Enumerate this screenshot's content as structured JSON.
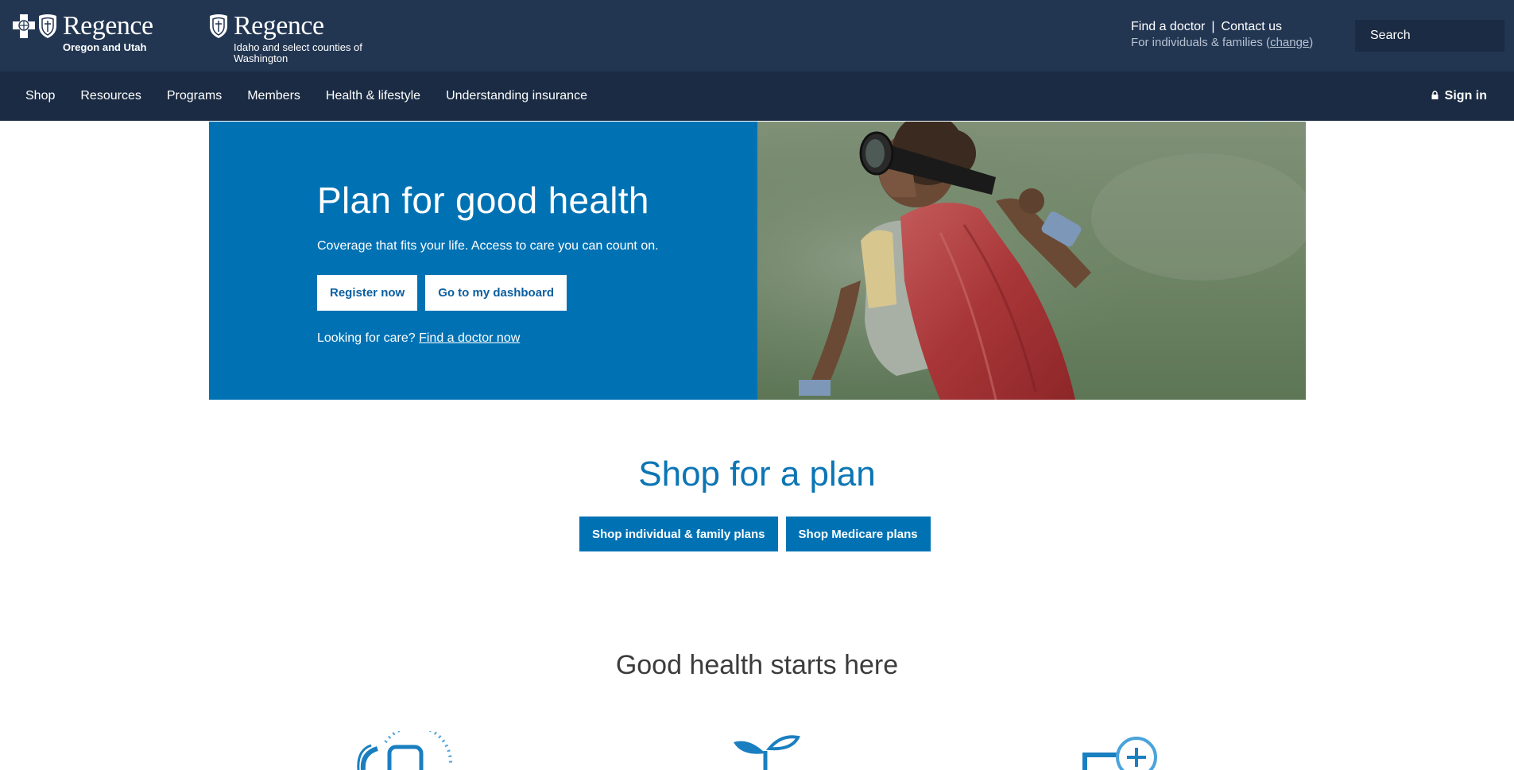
{
  "header": {
    "logo_left": {
      "brand": "Regence",
      "region": "Oregon and Utah"
    },
    "logo_right": {
      "brand": "Regence",
      "region": "Idaho and select counties of Washington"
    },
    "find_doctor": "Find a doctor",
    "separator": "|",
    "contact_us": "Contact us",
    "audience_prefix": "For individuals & families (",
    "audience_change": "change",
    "audience_suffix": ")",
    "search_placeholder": "Search"
  },
  "nav": {
    "items": [
      "Shop",
      "Resources",
      "Programs",
      "Members",
      "Health & lifestyle",
      "Understanding insurance"
    ],
    "sign_in": "Sign in"
  },
  "hero": {
    "title": "Plan for good health",
    "lead": "Coverage that fits your life. Access to care you can count on.",
    "register_button": "Register now",
    "dashboard_button": "Go to my dashboard",
    "care_prefix": "Looking for care?",
    "care_link": "Find a doctor now"
  },
  "shop": {
    "title": "Shop for a plan",
    "individual_button": "Shop individual & family plans",
    "medicare_button": "Shop Medicare plans"
  },
  "good_health": {
    "title": "Good health starts here"
  },
  "colors": {
    "header_bg": "#223652",
    "nav_bg": "#1a2b43",
    "hero_blue": "#0072b4",
    "accent_blue": "#0c75b4"
  }
}
